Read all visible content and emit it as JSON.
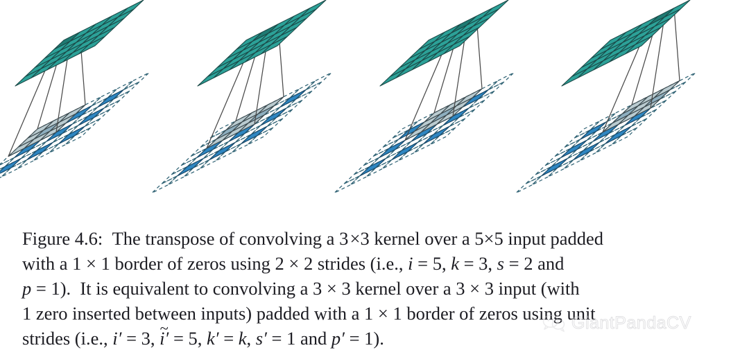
{
  "figure": {
    "label": "Figure 4.6:",
    "number": "4.6",
    "panel_count": 4,
    "colors": {
      "output_fill": "#2CA198",
      "output_highlight": "#1E7A72",
      "output_stroke": "#1b4a48",
      "input_fill": "#2E86C1",
      "input_highlight": "#1F6FA8",
      "input_stroke": "#1b4a6b",
      "kernel_fill": "#A9BEC4",
      "kernel_stroke": "#3d4a4f",
      "dashed_stroke": "#2F6274",
      "connector_stroke": "#4a4a4a",
      "caption_text": "#1c1c22"
    },
    "geometry": {
      "output_grid": "5x5",
      "input_padded_grid": "7x7",
      "kernel_grid": "3x3",
      "dilated_input": "5x5 (1 zero inserted between inputs)"
    },
    "panels": [
      {
        "name": "panel-1",
        "output_highlight_cell": [
          0,
          0
        ],
        "kernel_origin": [
          0,
          0
        ]
      },
      {
        "name": "panel-2",
        "output_highlight_cell": [
          0,
          1
        ],
        "kernel_origin": [
          0,
          1
        ]
      },
      {
        "name": "panel-3",
        "output_highlight_cell": [
          0,
          2
        ],
        "kernel_origin": [
          0,
          2
        ]
      },
      {
        "name": "panel-4",
        "output_highlight_cell": [
          0,
          3
        ],
        "kernel_origin": [
          0,
          3
        ]
      }
    ]
  },
  "caption": {
    "lines": [
      "Figure 4.6:  The transpose of convolving a 3 × 3 kernel over a 5 × 5 input padded",
      "with a 1 × 1 border of zeros using 2 × 2 strides (i.e., i = 5, k = 3, s = 2 and",
      "p = 1).  It is equivalent to convolving a 3 × 3 kernel over a 3 × 3 input (with",
      "1 zero inserted between inputs) padded with a 1 × 1 border of zeros using unit",
      "strides (i.e., i′ = 3, ĩ′ = 5, k′ = k, s′ = 1 and p′ = 1)."
    ],
    "line1": {
      "label": "Figure 4.6:",
      "t1": "The transpose of convolving a",
      "k1": "3",
      "x1": "×",
      "k2": "3",
      "t2": "kernel over a",
      "i1": "5",
      "x2": "×",
      "i2": "5",
      "t3": "input padded"
    },
    "line2": {
      "t1": "with a",
      "p1": "1",
      "x1": "×",
      "p2": "1",
      "t2": "border of zeros using",
      "s1": "2",
      "x2": "×",
      "s2": "2",
      "t3": "strides (i.e.,",
      "v_i": "i",
      "eq1": "=",
      "val_i": "5",
      "c1": ",",
      "v_k": "k",
      "eq2": "=",
      "val_k": "3",
      "c2": ",",
      "v_s": "s",
      "eq3": "=",
      "val_s": "2",
      "t4": "and"
    },
    "line3": {
      "v_p": "p",
      "eq1": "=",
      "val_p": "1",
      "t1": ").",
      "t2": "It is equivalent to convolving a",
      "k1": "3",
      "x1": "×",
      "k2": "3",
      "t3": "kernel over a",
      "i1": "3",
      "x2": "×",
      "i2": "3",
      "t4": "input (with"
    },
    "line4": {
      "n1": "1",
      "t1": "zero inserted between inputs) padded with a",
      "b1": "1",
      "x1": "×",
      "b2": "1",
      "t2": "border of zeros using unit"
    },
    "line5": {
      "t1": "strides (i.e.,",
      "v_ip": "i",
      "pr1": "′",
      "eq1": "=",
      "val_ip": "3",
      "c1": ",",
      "v_itp": "i",
      "pr2": "′",
      "eq2": "=",
      "val_itp": "5",
      "c2": ",",
      "v_kp": "k",
      "pr3": "′",
      "eq3": "=",
      "val_kp": "k",
      "c3": ",",
      "v_sp": "s",
      "pr4": "′",
      "eq4": "=",
      "val_sp": "1",
      "t2": "and",
      "v_pp": "p",
      "pr5": "′",
      "eq5": "=",
      "val_pp": "1",
      "t3": ")."
    }
  },
  "watermark": {
    "text": "GiantPandaCV",
    "icon": "wechat-icon"
  }
}
